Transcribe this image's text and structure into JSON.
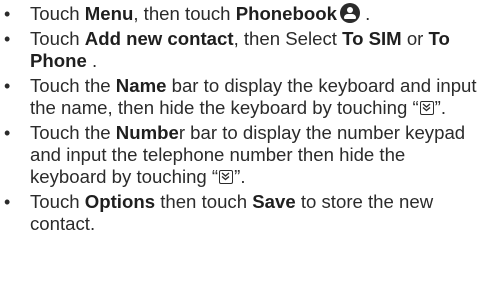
{
  "steps": [
    {
      "bullet": "•",
      "parts": [
        "Touch ",
        "Menu",
        ", then touch ",
        "Phonebook",
        " ."
      ]
    },
    {
      "bullet": "•",
      "parts": [
        "Touch ",
        "Add new contact",
        ", then Select ",
        "To SIM",
        " or ",
        "To Phone",
        " ."
      ]
    },
    {
      "bullet": "•",
      "parts": [
        "Touch the ",
        "Name",
        " bar to display the keyboard and input the name, then hide the keyboard by touching “",
        "”."
      ]
    },
    {
      "bullet": "•",
      "parts": [
        "Touch the ",
        "Numbe",
        "r bar to display the number keypad and input the telephone number then hide the keyboard by touching “",
        "”."
      ]
    },
    {
      "bullet": "•",
      "parts": [
        "Touch ",
        "Options",
        " then touch ",
        "Save",
        " to store the new contact."
      ]
    }
  ],
  "icons": {
    "phonebook": "phonebook-icon",
    "hide_keyboard": "hide-keyboard-icon"
  }
}
